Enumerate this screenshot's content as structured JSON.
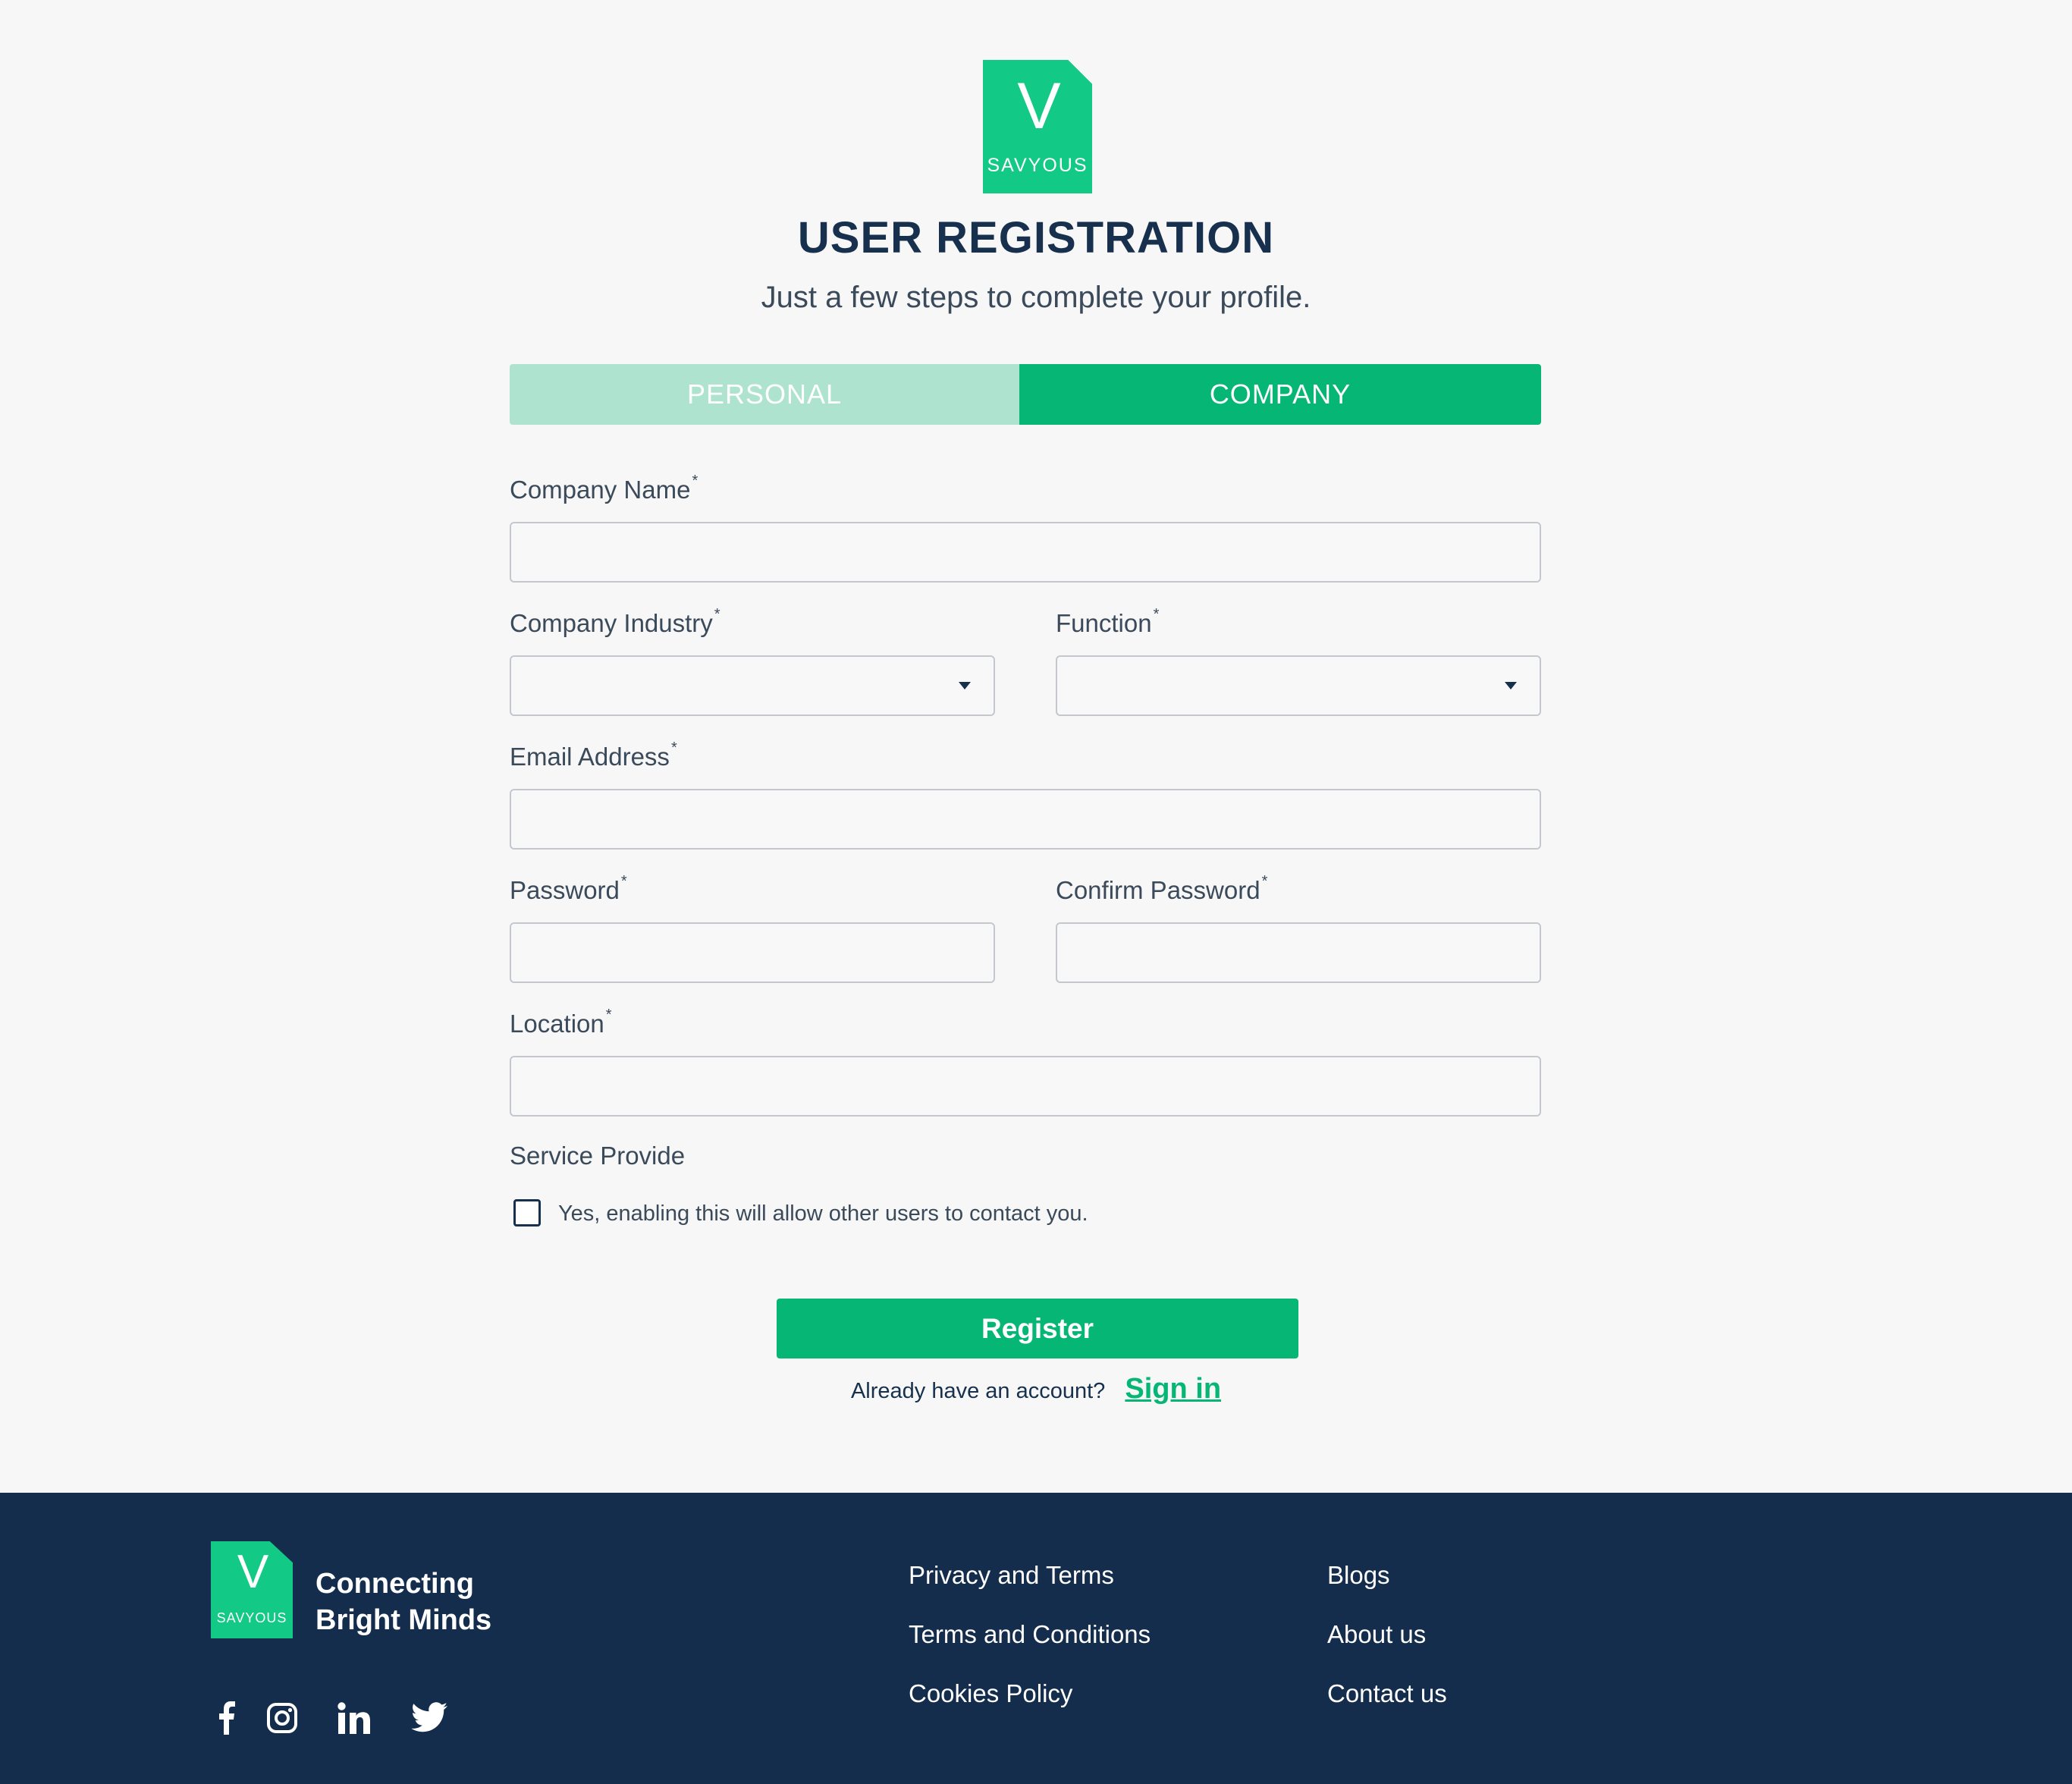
{
  "brand": {
    "logo_letter": "V",
    "logo_word": "SAVYOUS",
    "accent": "#06b674",
    "navy": "#142d4c"
  },
  "header": {
    "title": "USER REGISTRATION",
    "subtitle": "Just a few steps to complete your profile."
  },
  "tabs": [
    {
      "label": "PERSONAL",
      "active": false
    },
    {
      "label": "COMPANY",
      "active": true
    }
  ],
  "form": {
    "company_name": {
      "label": "Company Name",
      "required": "*",
      "value": ""
    },
    "company_industry": {
      "label": "Company Industry",
      "required": "*",
      "value": ""
    },
    "function": {
      "label": "Function",
      "required": "*",
      "value": ""
    },
    "email": {
      "label": "Email Address",
      "required": "*",
      "value": ""
    },
    "password": {
      "label": "Password",
      "required": "*",
      "value": ""
    },
    "confirm_password": {
      "label": "Confirm Password",
      "required": "*",
      "value": ""
    },
    "location": {
      "label": "Location",
      "required": "*",
      "value": ""
    },
    "service_provide": {
      "label": "Service Provide",
      "checkbox_text": "Yes, enabling this will allow other users to contact you.",
      "checked": false
    },
    "register_label": "Register",
    "signin_prompt": "Already have an account?",
    "signin_label": "Sign in"
  },
  "footer": {
    "logo_letter": "V",
    "logo_word": "SAVYOUS",
    "tagline_line1": "Connecting",
    "tagline_line2": "Bright Minds",
    "social": [
      "facebook-icon",
      "instagram-icon",
      "linkedin-icon",
      "twitter-icon"
    ],
    "links_col1": [
      "Privacy and Terms",
      "Terms and Conditions",
      "Cookies Policy"
    ],
    "links_col2": [
      "Blogs",
      "About us",
      "Contact us"
    ]
  }
}
